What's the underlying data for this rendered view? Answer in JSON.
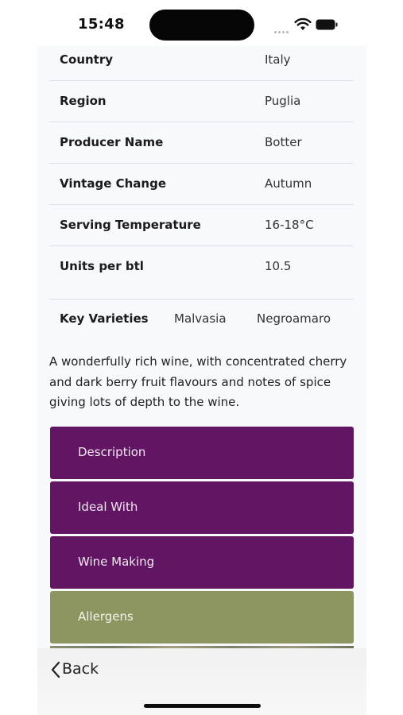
{
  "status": {
    "time": "15:48"
  },
  "info": [
    {
      "label": "Country",
      "value": "Italy"
    },
    {
      "label": "Region",
      "value": "Puglia"
    },
    {
      "label": "Producer Name",
      "value": "Botter"
    },
    {
      "label": "Vintage Change",
      "value": "Autumn"
    },
    {
      "label": "Serving Temperature",
      "value": "16-18°C"
    },
    {
      "label": "Units per btl",
      "value": "10.5"
    }
  ],
  "varieties": {
    "label": "Key Varieties",
    "items": [
      "Malvasia",
      "Negroamaro"
    ]
  },
  "description": "A wonderfully rich wine, with concentrated cherry and dark berry fruit flavours and notes of spice giving lots of depth to the wine.",
  "accordion": [
    "Description",
    "Ideal With",
    "Wine Making",
    "Allergens"
  ],
  "nav": {
    "back": "Back"
  },
  "colors": {
    "purple": "#611562",
    "olive": "#8d9660"
  }
}
